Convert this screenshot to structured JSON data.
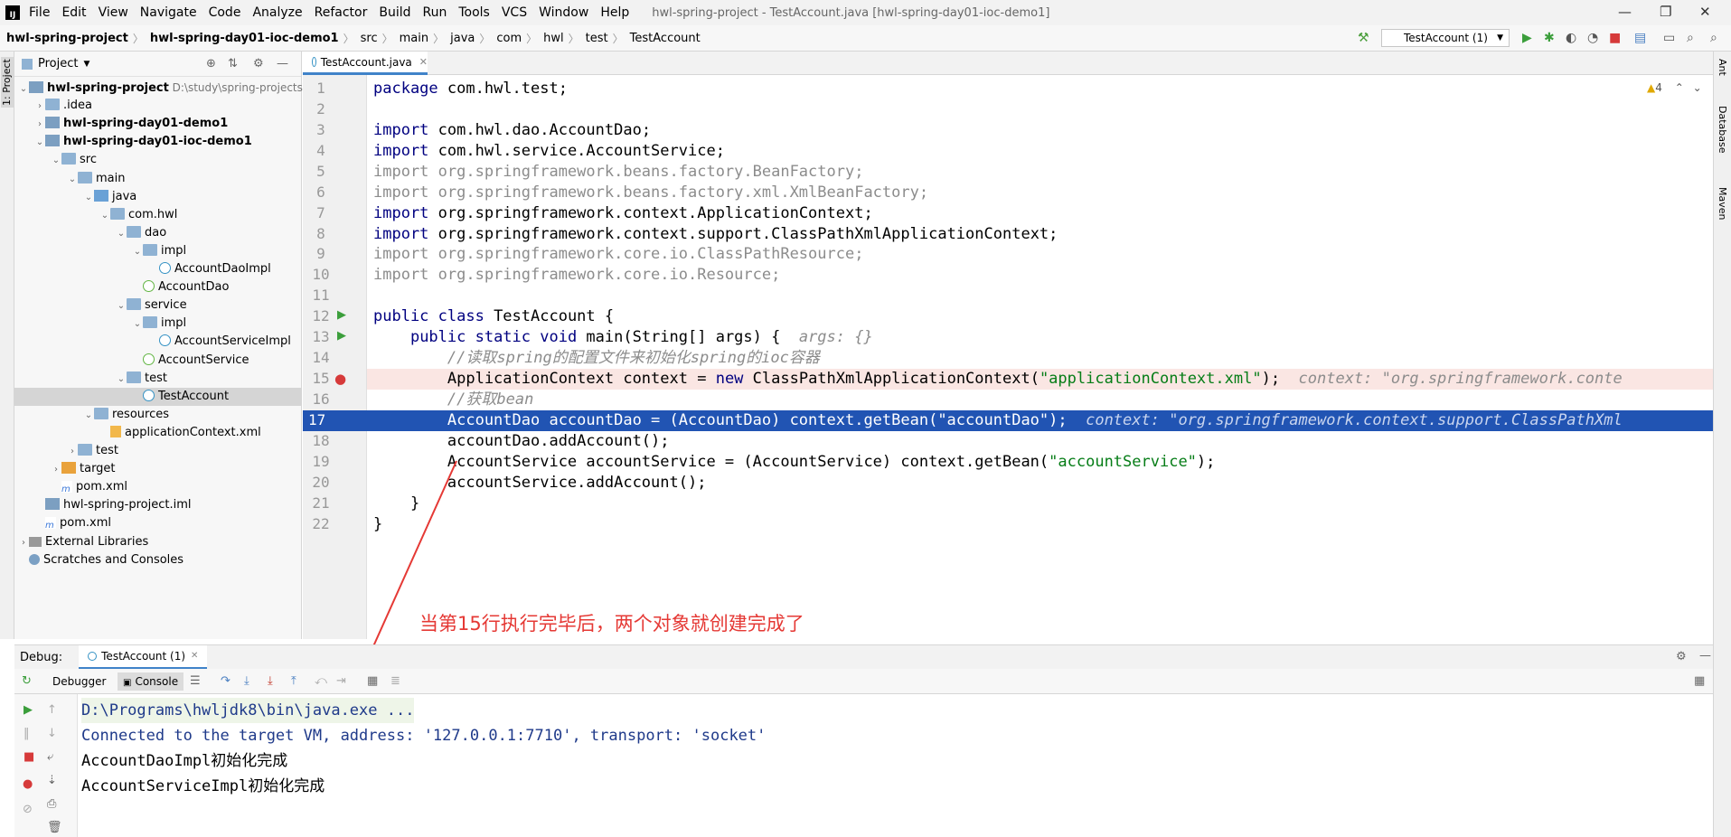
{
  "menubar": {
    "items": [
      "File",
      "Edit",
      "View",
      "Navigate",
      "Code",
      "Analyze",
      "Refactor",
      "Build",
      "Run",
      "Tools",
      "VCS",
      "Window",
      "Help"
    ],
    "window_title": "hwl-spring-project - TestAccount.java [hwl-spring-day01-ioc-demo1]"
  },
  "breadcrumb": [
    "hwl-spring-project",
    "hwl-spring-day01-ioc-demo1",
    "src",
    "main",
    "java",
    "com",
    "hwl",
    "test",
    "TestAccount"
  ],
  "run_config": "TestAccount (1)",
  "project_panel": {
    "title": "Project",
    "tree": [
      {
        "label": "hwl-spring-project",
        "path": "D:\\study\\spring-projects\\h",
        "bold": true,
        "indent": 0,
        "arrow": "v",
        "icon": "mod"
      },
      {
        "label": ".idea",
        "indent": 1,
        "arrow": ">",
        "icon": "folder"
      },
      {
        "label": "hwl-spring-day01-demo1",
        "bold": true,
        "indent": 1,
        "arrow": ">",
        "icon": "mod"
      },
      {
        "label": "hwl-spring-day01-ioc-demo1",
        "bold": true,
        "indent": 1,
        "arrow": "v",
        "icon": "mod"
      },
      {
        "label": "src",
        "indent": 2,
        "arrow": "v",
        "icon": "folder"
      },
      {
        "label": "main",
        "indent": 3,
        "arrow": "v",
        "icon": "folder"
      },
      {
        "label": "java",
        "indent": 4,
        "arrow": "v",
        "icon": "folder-src"
      },
      {
        "label": "com.hwl",
        "indent": 5,
        "arrow": "v",
        "icon": "folder"
      },
      {
        "label": "dao",
        "indent": 6,
        "arrow": "v",
        "icon": "folder"
      },
      {
        "label": "impl",
        "indent": 7,
        "arrow": "v",
        "icon": "folder"
      },
      {
        "label": "AccountDaoImpl",
        "indent": 8,
        "arrow": "",
        "icon": "cls"
      },
      {
        "label": "AccountDao",
        "indent": 7,
        "arrow": "",
        "icon": "intf"
      },
      {
        "label": "service",
        "indent": 6,
        "arrow": "v",
        "icon": "folder"
      },
      {
        "label": "impl",
        "indent": 7,
        "arrow": "v",
        "icon": "folder"
      },
      {
        "label": "AccountServiceImpl",
        "indent": 8,
        "arrow": "",
        "icon": "cls"
      },
      {
        "label": "AccountService",
        "indent": 7,
        "arrow": "",
        "icon": "intf"
      },
      {
        "label": "test",
        "indent": 6,
        "arrow": "v",
        "icon": "folder"
      },
      {
        "label": "TestAccount",
        "indent": 7,
        "arrow": "",
        "icon": "cls",
        "selected": true
      },
      {
        "label": "resources",
        "indent": 4,
        "arrow": "v",
        "icon": "folder"
      },
      {
        "label": "applicationContext.xml",
        "indent": 5,
        "arrow": "",
        "icon": "xml"
      },
      {
        "label": "test",
        "indent": 3,
        "arrow": ">",
        "icon": "folder"
      },
      {
        "label": "target",
        "indent": 2,
        "arrow": ">",
        "icon": "folder-orange"
      },
      {
        "label": "pom.xml",
        "indent": 2,
        "arrow": "",
        "icon": "mvn"
      },
      {
        "label": "hwl-spring-project.iml",
        "indent": 1,
        "arrow": "",
        "icon": "mod"
      },
      {
        "label": "pom.xml",
        "indent": 1,
        "arrow": "",
        "icon": "mvn"
      },
      {
        "label": "External Libraries",
        "indent": 0,
        "arrow": ">",
        "icon": "lib"
      },
      {
        "label": "Scratches and Consoles",
        "indent": 0,
        "arrow": "",
        "icon": "scr"
      }
    ]
  },
  "editor": {
    "tab": "TestAccount.java",
    "warnings": "4",
    "lines": [
      {
        "n": "1",
        "html": "<span class='kw'>package</span> com.hwl.test;"
      },
      {
        "n": "2",
        "html": ""
      },
      {
        "n": "3",
        "html": "<span class='kw'>import</span> com.hwl.dao.AccountDao;"
      },
      {
        "n": "4",
        "html": "<span class='kw'>import</span> com.hwl.service.AccountService;"
      },
      {
        "n": "5",
        "html": "<span class='gray'>import org.springframework.beans.factory.BeanFactory;</span>"
      },
      {
        "n": "6",
        "html": "<span class='gray'>import org.springframework.beans.factory.xml.XmlBeanFactory;</span>"
      },
      {
        "n": "7",
        "html": "<span class='kw'>import</span> org.springframework.context.ApplicationContext;"
      },
      {
        "n": "8",
        "html": "<span class='kw'>import</span> org.springframework.context.support.ClassPathXmlApplicationContext;"
      },
      {
        "n": "9",
        "html": "<span class='gray'>import org.springframework.core.io.ClassPathResource;</span>"
      },
      {
        "n": "10",
        "html": "<span class='gray'>import org.springframework.core.io.Resource;</span>"
      },
      {
        "n": "11",
        "html": ""
      },
      {
        "n": "12",
        "html": "<span class='kw'>public class</span> TestAccount {"
      },
      {
        "n": "13",
        "html": "    <span class='kw'>public static void</span> main(String[] args) {  <span class='hint'>args: {}</span>"
      },
      {
        "n": "14",
        "html": "        <span class='cmt'>//读取spring的配置文件来初始化spring的ioc容器</span>"
      },
      {
        "n": "15",
        "html": "        ApplicationContext context = <span class='kw'>new</span> ClassPathXmlApplicationContext(<span class='str'>\"applicationContext.xml\"</span>);  <span class='hint'>context: \"org.springframework.conte</span>",
        "cls": "err"
      },
      {
        "n": "16",
        "html": "        <span class='cmt'>//获取bean</span>"
      },
      {
        "n": "17",
        "html": "        AccountDao accountDao = (AccountDao) context.getBean(\"accountDao\");  <span class='hint'>context: \"org.springframework.context.support.ClassPathXml</span>",
        "cls": "cur"
      },
      {
        "n": "18",
        "html": "        accountDao.addAccount();"
      },
      {
        "n": "19",
        "html": "        AccountService accountService = (AccountService) context.getBean(<span class='str'>\"accountService\"</span>);"
      },
      {
        "n": "20",
        "html": "        accountService.addAccount();"
      },
      {
        "n": "21",
        "html": "    }"
      },
      {
        "n": "22",
        "html": "}"
      }
    ],
    "annotation": "当第15行执行完毕后，两个对象就创建完成了"
  },
  "debug": {
    "label": "Debug:",
    "tab": "TestAccount (1)",
    "debugger_tab": "Debugger",
    "console_tab": "Console",
    "console": [
      {
        "text": "D:\\Programs\\hwljdk8\\bin\\java.exe ...",
        "style": "blue"
      },
      {
        "text": "Connected to the target VM, address: '127.0.0.1:7710', transport: 'socket'",
        "style": "blue"
      },
      {
        "text": "AccountDaoImpl初始化完成",
        "style": ""
      },
      {
        "text": "AccountServiceImpl初始化完成",
        "style": ""
      }
    ]
  },
  "side_stripes": {
    "left": "1: Project",
    "right": [
      "Ant",
      "Database",
      "Maven"
    ]
  },
  "colors": {
    "accent": "#4083c9",
    "current_line": "#2154b3",
    "error_line": "#fae6e3",
    "annotation": "#e53935"
  }
}
